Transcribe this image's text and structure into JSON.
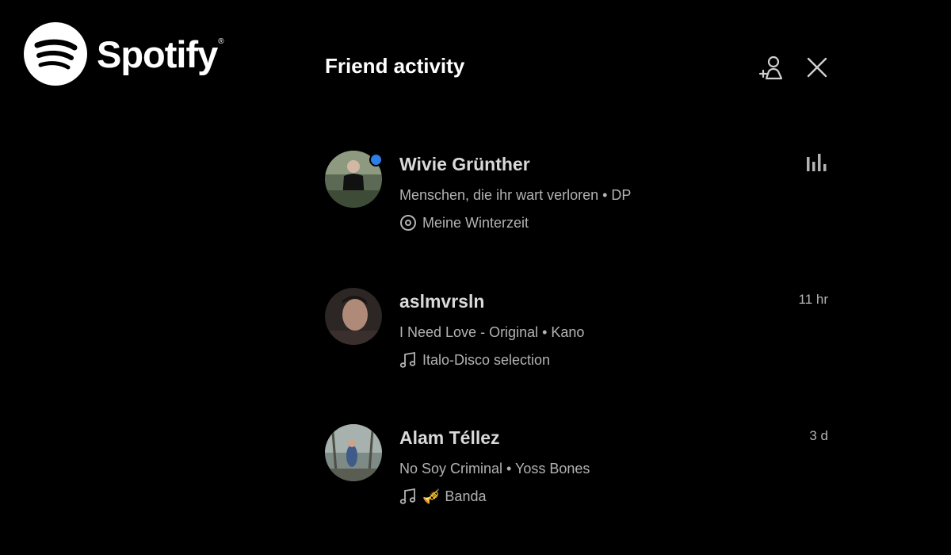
{
  "brand": {
    "name": "Spotify",
    "reg_mark": "®",
    "icon": "spotify-logo-icon",
    "color": "#ffffff"
  },
  "panel": {
    "title": "Friend activity",
    "add_friend_icon": "add-friend-icon",
    "close_icon": "close-icon"
  },
  "colors": {
    "background": "#000000",
    "online": "#2d7ee8",
    "secondary_text": "#b3b3b3"
  },
  "friends": [
    {
      "name": "Wivie Grünther",
      "track": "Menschen, die ihr wart verloren • DP",
      "context": "Meine Winterzeit",
      "context_icon": "album-disc-icon",
      "status": "now-playing-icon",
      "online": true
    },
    {
      "name": "aslmvrsln",
      "track": "I Need Love - Original • Kano",
      "context": "Italo-Disco selection",
      "context_icon": "music-note-icon",
      "time": "11 hr"
    },
    {
      "name": "Alam Téllez",
      "track": "No Soy Criminal • Yoss Bones",
      "context": "Banda",
      "context_emoji": "🎺",
      "context_icon": "music-note-icon",
      "time": "3 d"
    }
  ]
}
